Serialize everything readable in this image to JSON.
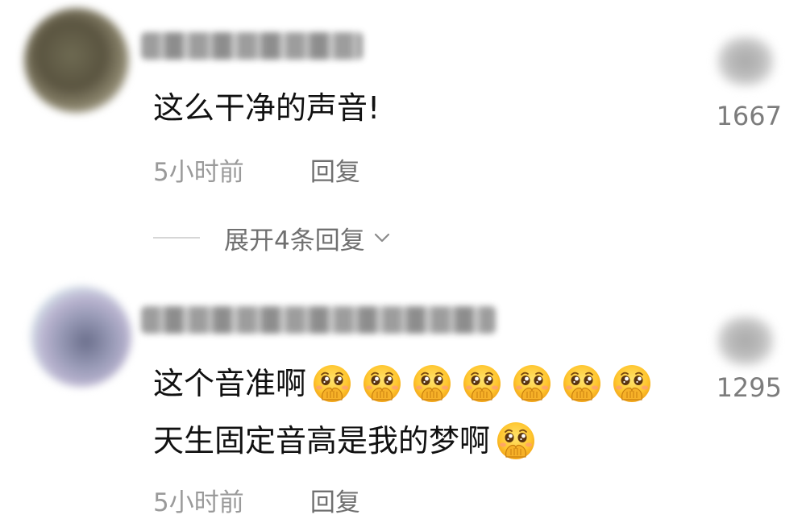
{
  "comments": [
    {
      "text_lines": [
        "这么干净的声音!"
      ],
      "time": "5小时前",
      "reply_label": "回复",
      "like_count": "1667",
      "expand_replies_label": "展开4条回复"
    },
    {
      "text_lines": [
        "这个音准啊",
        "天生固定音高是我的梦啊"
      ],
      "emoji_counts": [
        7,
        1
      ],
      "emoji_icon": "pleading-face-hands-over-mouth",
      "time": "5小时前",
      "reply_label": "回复",
      "like_count": "1295"
    }
  ],
  "colors": {
    "text_primary": "#111111",
    "text_secondary": "#9a9a9a",
    "text_tertiary": "#707070",
    "background": "#ffffff"
  }
}
